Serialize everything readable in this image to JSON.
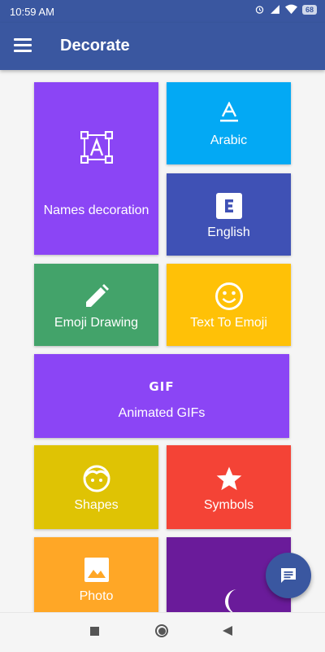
{
  "status_bar": {
    "time": "10:59 AM",
    "battery": "68"
  },
  "app_bar": {
    "title": "Decorate"
  },
  "tiles": {
    "names": {
      "label": "Names decoration",
      "icon": "letter-box-icon",
      "color": "#8b45f5"
    },
    "arabic": {
      "label": "Arabic",
      "icon": "text-format-icon",
      "color": "#03a9f4"
    },
    "english": {
      "label": "English",
      "icon": "letter-e-icon",
      "color": "#3f51b5"
    },
    "emoji_drawing": {
      "label": "Emoji Drawing",
      "icon": "pencil-icon",
      "color": "#43a36a"
    },
    "text_to_emoji": {
      "label": "Text To Emoji",
      "icon": "smiley-icon",
      "color": "#ffc107"
    },
    "gifs": {
      "label": "Animated GIFs",
      "icon": "gif-icon",
      "icon_text": "GIF",
      "color": "#8b45f5"
    },
    "shapes": {
      "label": "Shapes",
      "icon": "face-icon",
      "color": "#dfc304"
    },
    "symbols": {
      "label": "Symbols",
      "icon": "star-icon",
      "color": "#f44336"
    },
    "photo": {
      "label": "Photo",
      "icon": "image-icon",
      "color": "#ffa726"
    },
    "night": {
      "icon": "moon-icon",
      "color": "#6a1b9a"
    }
  },
  "fab": {
    "icon": "message-icon",
    "color": "#3a57a0"
  }
}
